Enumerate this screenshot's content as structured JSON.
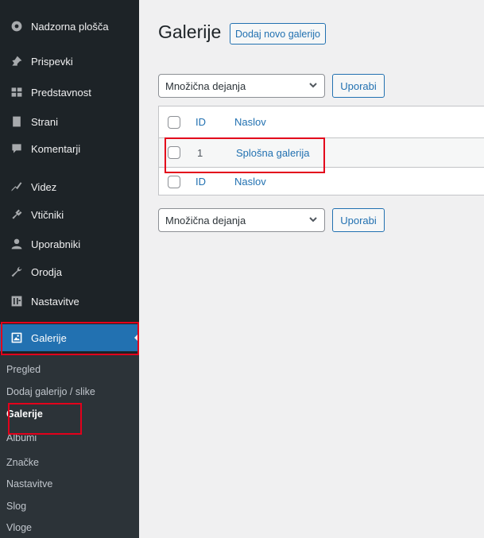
{
  "sidebar": {
    "items": [
      {
        "label": "Nadzorna plošča",
        "icon": "dashboard-icon"
      },
      {
        "label": "Prispevki",
        "icon": "pin-icon"
      },
      {
        "label": "Predstavnost",
        "icon": "media-icon"
      },
      {
        "label": "Strani",
        "icon": "page-icon"
      },
      {
        "label": "Komentarji",
        "icon": "comment-icon"
      },
      {
        "label": "Videz",
        "icon": "appearance-icon"
      },
      {
        "label": "Vtičniki",
        "icon": "plugin-icon"
      },
      {
        "label": "Uporabniki",
        "icon": "users-icon"
      },
      {
        "label": "Orodja",
        "icon": "wrench-icon"
      },
      {
        "label": "Nastavitve",
        "icon": "settings-icon"
      },
      {
        "label": "Galerije",
        "icon": "gallery-icon",
        "active": true
      }
    ],
    "submenu": [
      {
        "label": "Pregled"
      },
      {
        "label": "Dodaj galerijo / slike"
      },
      {
        "label": "Galerije",
        "current": true
      },
      {
        "label": "Albumi"
      },
      {
        "label": "Značke"
      },
      {
        "label": "Nastavitve"
      },
      {
        "label": "Slog"
      },
      {
        "label": "Vloge"
      }
    ]
  },
  "main": {
    "title": "Galerije",
    "add_new_label": "Dodaj novo galerijo",
    "bulk_actions_top": {
      "selected": "Množična dejanja",
      "apply_label": "Uporabi"
    },
    "bulk_actions_bottom": {
      "selected": "Množična dejanja",
      "apply_label": "Uporabi"
    },
    "table": {
      "columns": [
        "ID",
        "Naslov"
      ],
      "rows": [
        {
          "id": "1",
          "title": "Splošna galerija"
        }
      ]
    }
  },
  "colors": {
    "sidebar_bg": "#1d2327",
    "submenu_bg": "#2c3338",
    "accent": "#2271b1",
    "highlight": "#e3001b"
  }
}
